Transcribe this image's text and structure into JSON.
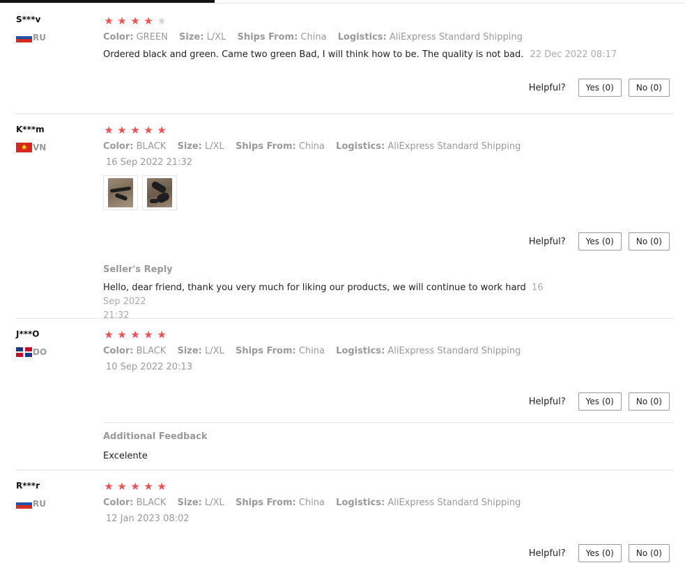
{
  "labels": {
    "color": "Color:",
    "size": "Size:",
    "ships_from": "Ships From:",
    "logistics": "Logistics:",
    "helpful": "Helpful?",
    "seller_reply": "Seller's Reply",
    "additional_feedback": "Additional Feedback"
  },
  "colors": {
    "star": "#f44e4e",
    "star_off": "#d4d4d4"
  },
  "reviews": [
    {
      "user": "S***v",
      "country": "RU",
      "flag": "russia-flag",
      "rating": 4,
      "color": "GREEN",
      "size": "L/XL",
      "ships_from": "China",
      "logistics": "AliExpress Standard Shipping",
      "text": "Ordered black and green. Came two green Bad, I will think how to be. The quality is not bad.",
      "date": "22 Dec 2022 08:17",
      "yes": "Yes (0)",
      "no": "No (0)"
    },
    {
      "user": "K***m",
      "country": "VN",
      "flag": "vietnam-flag",
      "rating": 5,
      "color": "BLACK",
      "size": "L/XL",
      "ships_from": "China",
      "logistics": "AliExpress Standard Shipping",
      "date": "16 Sep 2022 21:32",
      "yes": "Yes (0)",
      "no": "No (0)",
      "seller_reply": {
        "text": "Hello, dear friend, thank you very much for liking our products, we will continue to work hard",
        "date_part1": "16 Sep 2022",
        "date_part2": "21:32"
      }
    },
    {
      "user": "J***O",
      "country": "DO",
      "flag": "dominican-republic-flag",
      "rating": 5,
      "color": "BLACK",
      "size": "L/XL",
      "ships_from": "China",
      "logistics": "AliExpress Standard Shipping",
      "date": "10 Sep 2022 20:13",
      "yes": "Yes (0)",
      "no": "No (0)",
      "additional_feedback": "Excelente"
    },
    {
      "user": "R***r",
      "country": "RU",
      "flag": "russia-flag",
      "rating": 5,
      "color": "BLACK",
      "size": "L/XL",
      "ships_from": "China",
      "logistics": "AliExpress Standard Shipping",
      "date": "12 Jan 2023 08:02",
      "yes": "Yes (0)",
      "no": "No (0)"
    }
  ]
}
